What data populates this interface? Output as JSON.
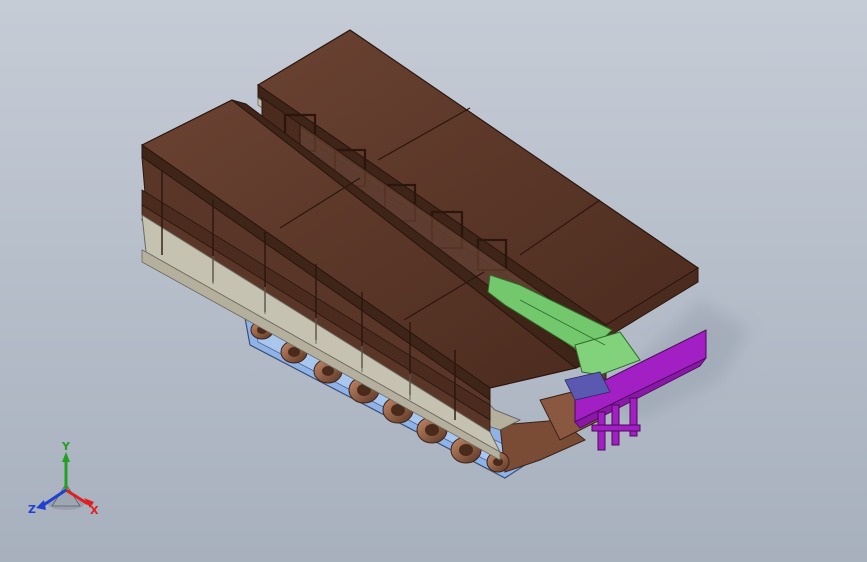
{
  "viewport": {
    "background_top": "#c6ccd6",
    "background_bottom": "#a7b0bd"
  },
  "model": {
    "colors": {
      "deck": "#5a3628",
      "deck_dark": "#3f2418",
      "side_panel": "#c6c2b2",
      "track": "#8fb3e6",
      "road_wheel": "#7a4b35",
      "green_part": "#73c86e",
      "magenta_part": "#a21fc4"
    }
  },
  "triad": {
    "x_label": "X",
    "y_label": "Y",
    "z_label": "Z",
    "x_color": "#e02020",
    "y_color": "#22a022",
    "z_color": "#2040d0"
  }
}
